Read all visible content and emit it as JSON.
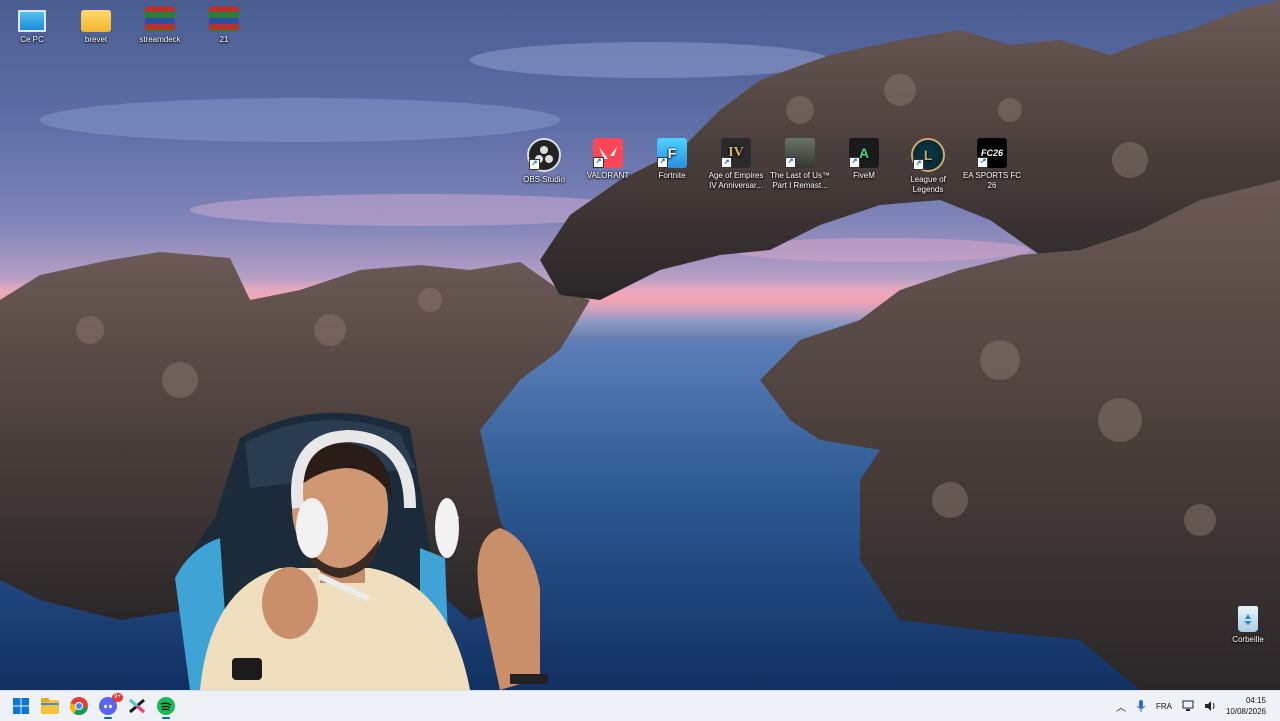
{
  "desktop_icons": {
    "this_pc": "Ce PC",
    "brevet": "brevet",
    "streamdeck": "streamdeck",
    "archive_21": "21",
    "obs": "OBS Studio",
    "valorant": "VALORANT",
    "fortnite": "Fortnite",
    "aoe": "Age of Empires IV Anniversar...",
    "tlou": "The Last of Us™ Part I Remast...",
    "fivem": "FiveM",
    "lol": "League of Legends",
    "fc26": "EA SPORTS FC 26",
    "recycle_bin": "Corbeille"
  },
  "icon_glyphs": {
    "fortnite": "F",
    "aoe": "IV",
    "fivem": "A",
    "lol": "L",
    "fc26": "FC26"
  },
  "taskbar": {
    "apps": [
      "start-icon",
      "file-explorer-icon",
      "chrome-icon",
      "discord-icon",
      "capcut-icon",
      "spotify-icon"
    ],
    "discord_badge": "9+"
  },
  "tray": {
    "language": "FRA",
    "time": "04:15",
    "date": "10/08/2026"
  },
  "colors": {
    "accent": "#0067c0",
    "valorant_red": "#ff4655",
    "spotify_green": "#1db954"
  }
}
